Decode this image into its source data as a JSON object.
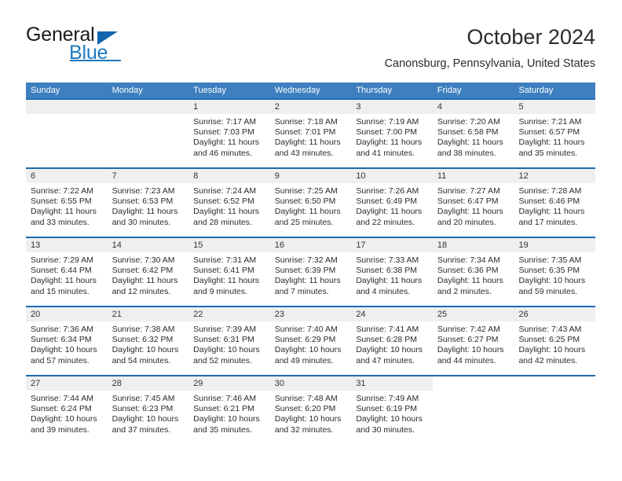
{
  "brand": {
    "name_part1": "General",
    "name_part2": "Blue"
  },
  "header": {
    "month_title": "October 2024",
    "location": "Canonsburg, Pennsylvania, United States"
  },
  "calendar": {
    "weekdays": [
      "Sunday",
      "Monday",
      "Tuesday",
      "Wednesday",
      "Thursday",
      "Friday",
      "Saturday"
    ],
    "header_bg": "#3d7fbf",
    "row_border": "#1e6cb0",
    "daynum_bg": "#efefef",
    "weeks": [
      [
        {
          "empty": true
        },
        {
          "empty": true
        },
        {
          "day": "1",
          "sunrise": "Sunrise: 7:17 AM",
          "sunset": "Sunset: 7:03 PM",
          "daylight1": "Daylight: 11 hours",
          "daylight2": "and 46 minutes."
        },
        {
          "day": "2",
          "sunrise": "Sunrise: 7:18 AM",
          "sunset": "Sunset: 7:01 PM",
          "daylight1": "Daylight: 11 hours",
          "daylight2": "and 43 minutes."
        },
        {
          "day": "3",
          "sunrise": "Sunrise: 7:19 AM",
          "sunset": "Sunset: 7:00 PM",
          "daylight1": "Daylight: 11 hours",
          "daylight2": "and 41 minutes."
        },
        {
          "day": "4",
          "sunrise": "Sunrise: 7:20 AM",
          "sunset": "Sunset: 6:58 PM",
          "daylight1": "Daylight: 11 hours",
          "daylight2": "and 38 minutes."
        },
        {
          "day": "5",
          "sunrise": "Sunrise: 7:21 AM",
          "sunset": "Sunset: 6:57 PM",
          "daylight1": "Daylight: 11 hours",
          "daylight2": "and 35 minutes."
        }
      ],
      [
        {
          "day": "6",
          "sunrise": "Sunrise: 7:22 AM",
          "sunset": "Sunset: 6:55 PM",
          "daylight1": "Daylight: 11 hours",
          "daylight2": "and 33 minutes."
        },
        {
          "day": "7",
          "sunrise": "Sunrise: 7:23 AM",
          "sunset": "Sunset: 6:53 PM",
          "daylight1": "Daylight: 11 hours",
          "daylight2": "and 30 minutes."
        },
        {
          "day": "8",
          "sunrise": "Sunrise: 7:24 AM",
          "sunset": "Sunset: 6:52 PM",
          "daylight1": "Daylight: 11 hours",
          "daylight2": "and 28 minutes."
        },
        {
          "day": "9",
          "sunrise": "Sunrise: 7:25 AM",
          "sunset": "Sunset: 6:50 PM",
          "daylight1": "Daylight: 11 hours",
          "daylight2": "and 25 minutes."
        },
        {
          "day": "10",
          "sunrise": "Sunrise: 7:26 AM",
          "sunset": "Sunset: 6:49 PM",
          "daylight1": "Daylight: 11 hours",
          "daylight2": "and 22 minutes."
        },
        {
          "day": "11",
          "sunrise": "Sunrise: 7:27 AM",
          "sunset": "Sunset: 6:47 PM",
          "daylight1": "Daylight: 11 hours",
          "daylight2": "and 20 minutes."
        },
        {
          "day": "12",
          "sunrise": "Sunrise: 7:28 AM",
          "sunset": "Sunset: 6:46 PM",
          "daylight1": "Daylight: 11 hours",
          "daylight2": "and 17 minutes."
        }
      ],
      [
        {
          "day": "13",
          "sunrise": "Sunrise: 7:29 AM",
          "sunset": "Sunset: 6:44 PM",
          "daylight1": "Daylight: 11 hours",
          "daylight2": "and 15 minutes."
        },
        {
          "day": "14",
          "sunrise": "Sunrise: 7:30 AM",
          "sunset": "Sunset: 6:42 PM",
          "daylight1": "Daylight: 11 hours",
          "daylight2": "and 12 minutes."
        },
        {
          "day": "15",
          "sunrise": "Sunrise: 7:31 AM",
          "sunset": "Sunset: 6:41 PM",
          "daylight1": "Daylight: 11 hours",
          "daylight2": "and 9 minutes."
        },
        {
          "day": "16",
          "sunrise": "Sunrise: 7:32 AM",
          "sunset": "Sunset: 6:39 PM",
          "daylight1": "Daylight: 11 hours",
          "daylight2": "and 7 minutes."
        },
        {
          "day": "17",
          "sunrise": "Sunrise: 7:33 AM",
          "sunset": "Sunset: 6:38 PM",
          "daylight1": "Daylight: 11 hours",
          "daylight2": "and 4 minutes."
        },
        {
          "day": "18",
          "sunrise": "Sunrise: 7:34 AM",
          "sunset": "Sunset: 6:36 PM",
          "daylight1": "Daylight: 11 hours",
          "daylight2": "and 2 minutes."
        },
        {
          "day": "19",
          "sunrise": "Sunrise: 7:35 AM",
          "sunset": "Sunset: 6:35 PM",
          "daylight1": "Daylight: 10 hours",
          "daylight2": "and 59 minutes."
        }
      ],
      [
        {
          "day": "20",
          "sunrise": "Sunrise: 7:36 AM",
          "sunset": "Sunset: 6:34 PM",
          "daylight1": "Daylight: 10 hours",
          "daylight2": "and 57 minutes."
        },
        {
          "day": "21",
          "sunrise": "Sunrise: 7:38 AM",
          "sunset": "Sunset: 6:32 PM",
          "daylight1": "Daylight: 10 hours",
          "daylight2": "and 54 minutes."
        },
        {
          "day": "22",
          "sunrise": "Sunrise: 7:39 AM",
          "sunset": "Sunset: 6:31 PM",
          "daylight1": "Daylight: 10 hours",
          "daylight2": "and 52 minutes."
        },
        {
          "day": "23",
          "sunrise": "Sunrise: 7:40 AM",
          "sunset": "Sunset: 6:29 PM",
          "daylight1": "Daylight: 10 hours",
          "daylight2": "and 49 minutes."
        },
        {
          "day": "24",
          "sunrise": "Sunrise: 7:41 AM",
          "sunset": "Sunset: 6:28 PM",
          "daylight1": "Daylight: 10 hours",
          "daylight2": "and 47 minutes."
        },
        {
          "day": "25",
          "sunrise": "Sunrise: 7:42 AM",
          "sunset": "Sunset: 6:27 PM",
          "daylight1": "Daylight: 10 hours",
          "daylight2": "and 44 minutes."
        },
        {
          "day": "26",
          "sunrise": "Sunrise: 7:43 AM",
          "sunset": "Sunset: 6:25 PM",
          "daylight1": "Daylight: 10 hours",
          "daylight2": "and 42 minutes."
        }
      ],
      [
        {
          "day": "27",
          "sunrise": "Sunrise: 7:44 AM",
          "sunset": "Sunset: 6:24 PM",
          "daylight1": "Daylight: 10 hours",
          "daylight2": "and 39 minutes."
        },
        {
          "day": "28",
          "sunrise": "Sunrise: 7:45 AM",
          "sunset": "Sunset: 6:23 PM",
          "daylight1": "Daylight: 10 hours",
          "daylight2": "and 37 minutes."
        },
        {
          "day": "29",
          "sunrise": "Sunrise: 7:46 AM",
          "sunset": "Sunset: 6:21 PM",
          "daylight1": "Daylight: 10 hours",
          "daylight2": "and 35 minutes."
        },
        {
          "day": "30",
          "sunrise": "Sunrise: 7:48 AM",
          "sunset": "Sunset: 6:20 PM",
          "daylight1": "Daylight: 10 hours",
          "daylight2": "and 32 minutes."
        },
        {
          "day": "31",
          "sunrise": "Sunrise: 7:49 AM",
          "sunset": "Sunset: 6:19 PM",
          "daylight1": "Daylight: 10 hours",
          "daylight2": "and 30 minutes."
        },
        {
          "blank": true
        },
        {
          "blank": true
        }
      ]
    ]
  }
}
